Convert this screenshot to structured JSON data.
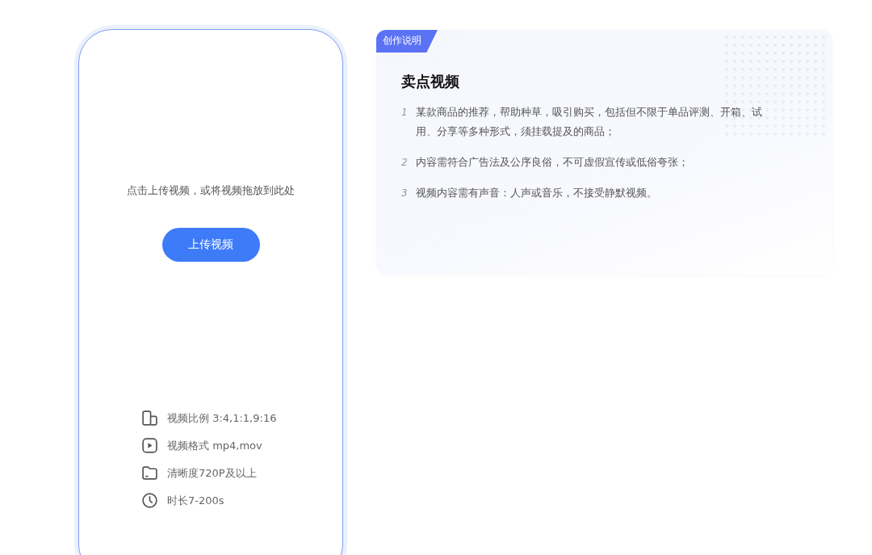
{
  "upload": {
    "hint": "点击上传视频，或将视频拖放到此处",
    "button": "上传视频",
    "requirements": [
      {
        "kind": "ratio",
        "text": "视频比例 3:4,1:1,9:16"
      },
      {
        "kind": "format",
        "text": "视频格式 mp4,mov"
      },
      {
        "kind": "resolution",
        "text": "清晰度720P及以上"
      },
      {
        "kind": "duration",
        "text": "时长7-200s"
      }
    ]
  },
  "guide": {
    "tag": "创作说明",
    "title": "卖点视频",
    "items": [
      {
        "number": "1",
        "text": "某款商品的推荐，帮助种草，吸引购买，包括但不限于单品评测、开箱、试用、分享等多种形式，须挂载提及的商品；"
      },
      {
        "number": "2",
        "text": "内容需符合广告法及公序良俗，不可虚假宣传或低俗夸张；"
      },
      {
        "number": "3",
        "text": "视频内容需有声音：人声或音乐，不接受静默视频。"
      }
    ]
  }
}
